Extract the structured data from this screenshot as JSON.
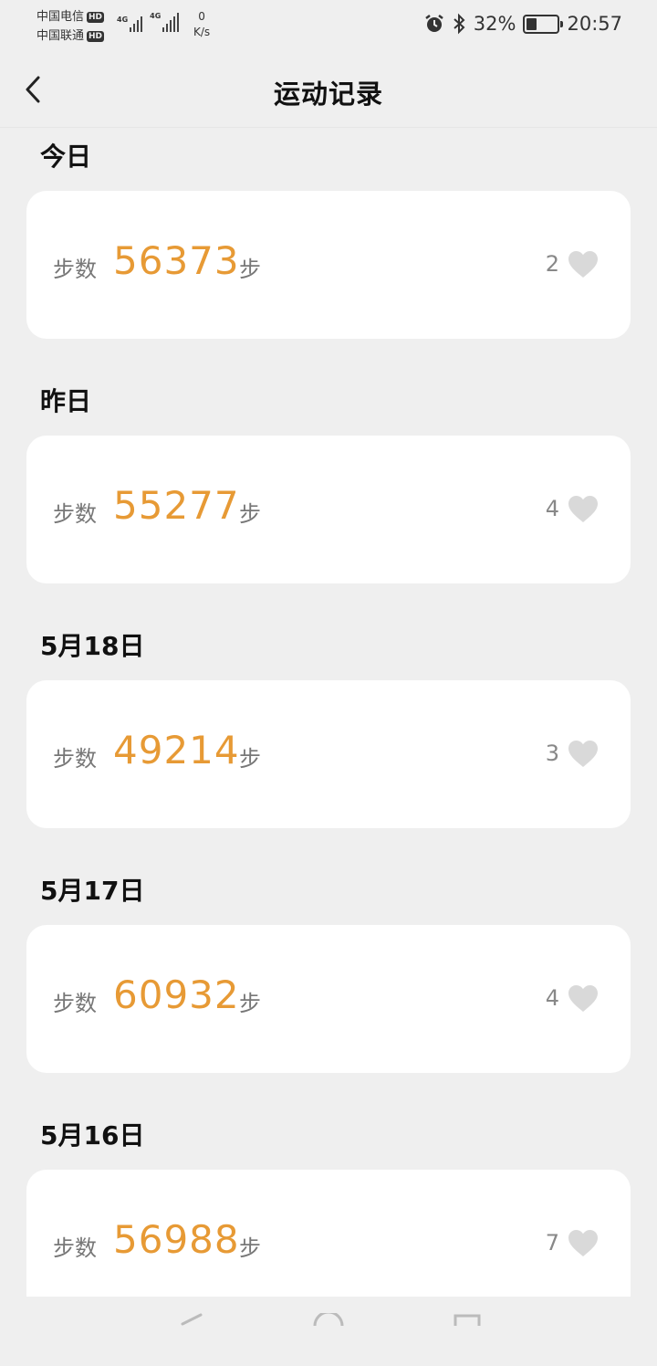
{
  "status_bar": {
    "carrier_1": "中国电信",
    "carrier_2": "中国联通",
    "hd_badge": "HD",
    "network_type": "4G",
    "speed_value": "0",
    "speed_unit": "K/s",
    "battery_percent": "32%",
    "battery_level": 0.32,
    "time": "20:57",
    "icons": [
      "alarm-icon",
      "bluetooth-icon",
      "battery-icon"
    ]
  },
  "header": {
    "title": "运动记录"
  },
  "records": [
    {
      "day": "今日",
      "steps_label": "步数",
      "steps": "56373",
      "unit": "步",
      "likes": "2"
    },
    {
      "day": "昨日",
      "steps_label": "步数",
      "steps": "55277",
      "unit": "步",
      "likes": "4"
    },
    {
      "day": "5月18日",
      "steps_label": "步数",
      "steps": "49214",
      "unit": "步",
      "likes": "3"
    },
    {
      "day": "5月17日",
      "steps_label": "步数",
      "steps": "60932",
      "unit": "步",
      "likes": "4"
    },
    {
      "day": "5月16日",
      "steps_label": "步数",
      "steps": "56988",
      "unit": "步",
      "likes": "7"
    }
  ],
  "colors": {
    "accent": "#e79a35",
    "background": "#efefef",
    "card": "#ffffff",
    "heart": "#d9d9d9"
  }
}
